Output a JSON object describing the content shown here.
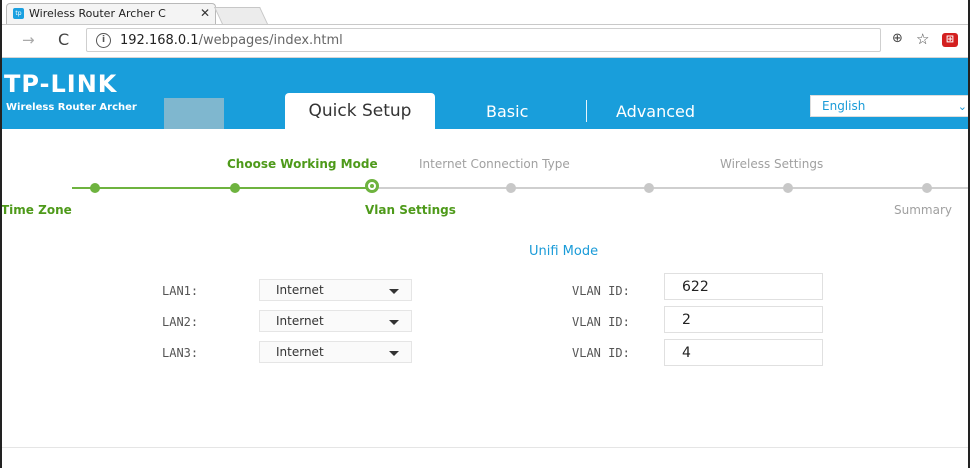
{
  "browser": {
    "tab_title": "Wireless Router Archer C",
    "tab_close": "✕",
    "url_host": "192.168.0.1",
    "url_path": "/webpages/index.html"
  },
  "header": {
    "logo": "TP-LINK",
    "model": "Wireless Router Archer",
    "nav": {
      "quick_setup": "Quick Setup",
      "basic": "Basic",
      "advanced": "Advanced"
    },
    "language": "English",
    "accent_color": "#199edb"
  },
  "progress": {
    "steps_top": [
      "Choose Working Mode",
      "Internet Connection Type",
      "Wireless Settings"
    ],
    "steps_bottom": [
      "Time Zone",
      "Vlan Settings",
      "Summary"
    ],
    "current_step": "Vlan Settings",
    "done_color": "#6eb33f"
  },
  "form": {
    "section_title": "Unifi Mode",
    "rows": [
      {
        "lan_label": "LAN1:",
        "lan_value": "Internet",
        "vlan_label": "VLAN ID:",
        "vlan_value": "622"
      },
      {
        "lan_label": "LAN2:",
        "lan_value": "Internet",
        "vlan_label": "VLAN ID:",
        "vlan_value": "2"
      },
      {
        "lan_label": "LAN3:",
        "lan_value": "Internet",
        "vlan_label": "VLAN ID:",
        "vlan_value": "4"
      }
    ]
  }
}
